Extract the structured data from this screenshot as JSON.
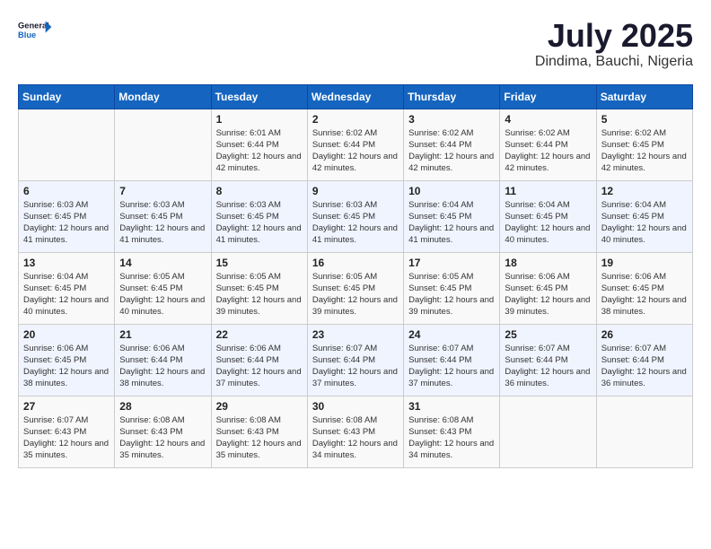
{
  "header": {
    "logo_general": "General",
    "logo_blue": "Blue",
    "month_year": "July 2025",
    "location": "Dindima, Bauchi, Nigeria"
  },
  "weekdays": [
    "Sunday",
    "Monday",
    "Tuesday",
    "Wednesday",
    "Thursday",
    "Friday",
    "Saturday"
  ],
  "weeks": [
    [
      {
        "day": "",
        "info": ""
      },
      {
        "day": "",
        "info": ""
      },
      {
        "day": "1",
        "info": "Sunrise: 6:01 AM\nSunset: 6:44 PM\nDaylight: 12 hours and 42 minutes."
      },
      {
        "day": "2",
        "info": "Sunrise: 6:02 AM\nSunset: 6:44 PM\nDaylight: 12 hours and 42 minutes."
      },
      {
        "day": "3",
        "info": "Sunrise: 6:02 AM\nSunset: 6:44 PM\nDaylight: 12 hours and 42 minutes."
      },
      {
        "day": "4",
        "info": "Sunrise: 6:02 AM\nSunset: 6:44 PM\nDaylight: 12 hours and 42 minutes."
      },
      {
        "day": "5",
        "info": "Sunrise: 6:02 AM\nSunset: 6:45 PM\nDaylight: 12 hours and 42 minutes."
      }
    ],
    [
      {
        "day": "6",
        "info": "Sunrise: 6:03 AM\nSunset: 6:45 PM\nDaylight: 12 hours and 41 minutes."
      },
      {
        "day": "7",
        "info": "Sunrise: 6:03 AM\nSunset: 6:45 PM\nDaylight: 12 hours and 41 minutes."
      },
      {
        "day": "8",
        "info": "Sunrise: 6:03 AM\nSunset: 6:45 PM\nDaylight: 12 hours and 41 minutes."
      },
      {
        "day": "9",
        "info": "Sunrise: 6:03 AM\nSunset: 6:45 PM\nDaylight: 12 hours and 41 minutes."
      },
      {
        "day": "10",
        "info": "Sunrise: 6:04 AM\nSunset: 6:45 PM\nDaylight: 12 hours and 41 minutes."
      },
      {
        "day": "11",
        "info": "Sunrise: 6:04 AM\nSunset: 6:45 PM\nDaylight: 12 hours and 40 minutes."
      },
      {
        "day": "12",
        "info": "Sunrise: 6:04 AM\nSunset: 6:45 PM\nDaylight: 12 hours and 40 minutes."
      }
    ],
    [
      {
        "day": "13",
        "info": "Sunrise: 6:04 AM\nSunset: 6:45 PM\nDaylight: 12 hours and 40 minutes."
      },
      {
        "day": "14",
        "info": "Sunrise: 6:05 AM\nSunset: 6:45 PM\nDaylight: 12 hours and 40 minutes."
      },
      {
        "day": "15",
        "info": "Sunrise: 6:05 AM\nSunset: 6:45 PM\nDaylight: 12 hours and 39 minutes."
      },
      {
        "day": "16",
        "info": "Sunrise: 6:05 AM\nSunset: 6:45 PM\nDaylight: 12 hours and 39 minutes."
      },
      {
        "day": "17",
        "info": "Sunrise: 6:05 AM\nSunset: 6:45 PM\nDaylight: 12 hours and 39 minutes."
      },
      {
        "day": "18",
        "info": "Sunrise: 6:06 AM\nSunset: 6:45 PM\nDaylight: 12 hours and 39 minutes."
      },
      {
        "day": "19",
        "info": "Sunrise: 6:06 AM\nSunset: 6:45 PM\nDaylight: 12 hours and 38 minutes."
      }
    ],
    [
      {
        "day": "20",
        "info": "Sunrise: 6:06 AM\nSunset: 6:45 PM\nDaylight: 12 hours and 38 minutes."
      },
      {
        "day": "21",
        "info": "Sunrise: 6:06 AM\nSunset: 6:44 PM\nDaylight: 12 hours and 38 minutes."
      },
      {
        "day": "22",
        "info": "Sunrise: 6:06 AM\nSunset: 6:44 PM\nDaylight: 12 hours and 37 minutes."
      },
      {
        "day": "23",
        "info": "Sunrise: 6:07 AM\nSunset: 6:44 PM\nDaylight: 12 hours and 37 minutes."
      },
      {
        "day": "24",
        "info": "Sunrise: 6:07 AM\nSunset: 6:44 PM\nDaylight: 12 hours and 37 minutes."
      },
      {
        "day": "25",
        "info": "Sunrise: 6:07 AM\nSunset: 6:44 PM\nDaylight: 12 hours and 36 minutes."
      },
      {
        "day": "26",
        "info": "Sunrise: 6:07 AM\nSunset: 6:44 PM\nDaylight: 12 hours and 36 minutes."
      }
    ],
    [
      {
        "day": "27",
        "info": "Sunrise: 6:07 AM\nSunset: 6:43 PM\nDaylight: 12 hours and 35 minutes."
      },
      {
        "day": "28",
        "info": "Sunrise: 6:08 AM\nSunset: 6:43 PM\nDaylight: 12 hours and 35 minutes."
      },
      {
        "day": "29",
        "info": "Sunrise: 6:08 AM\nSunset: 6:43 PM\nDaylight: 12 hours and 35 minutes."
      },
      {
        "day": "30",
        "info": "Sunrise: 6:08 AM\nSunset: 6:43 PM\nDaylight: 12 hours and 34 minutes."
      },
      {
        "day": "31",
        "info": "Sunrise: 6:08 AM\nSunset: 6:43 PM\nDaylight: 12 hours and 34 minutes."
      },
      {
        "day": "",
        "info": ""
      },
      {
        "day": "",
        "info": ""
      }
    ]
  ]
}
